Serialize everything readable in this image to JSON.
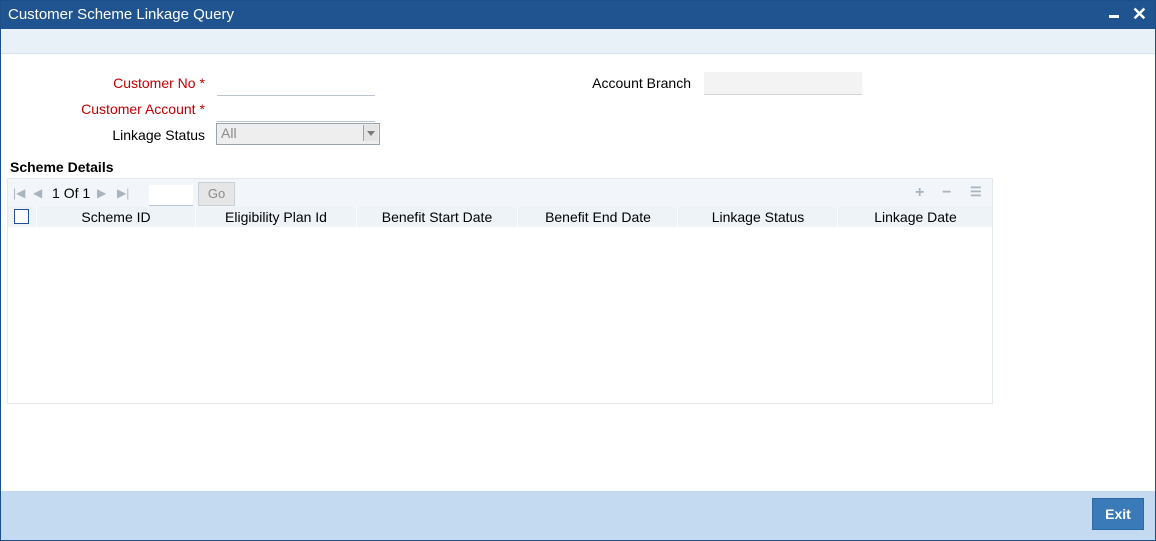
{
  "window": {
    "title": "Customer Scheme Linkage Query"
  },
  "form": {
    "customer_no_label": "Customer No",
    "customer_account_label": "Customer Account",
    "linkage_status_label": "Linkage Status",
    "linkage_status_value": "All",
    "account_branch_label": "Account Branch",
    "required_mark": "*"
  },
  "scheme_details": {
    "title": "Scheme Details",
    "page_current": "1",
    "page_of": "Of",
    "page_total": "1",
    "go_label": "Go",
    "columns": [
      "Scheme ID",
      "Eligibility Plan Id",
      "Benefit Start Date",
      "Benefit End Date",
      "Linkage Status",
      "Linkage Date"
    ]
  },
  "footer": {
    "exit_label": "Exit"
  },
  "colors": {
    "titlebar": "#1f5491",
    "required": "#c00000",
    "footer": "#c3daf0",
    "exit_button": "#3a7ab8"
  },
  "icons": [
    "minimize-icon",
    "close-icon",
    "first-page-icon",
    "prev-page-icon",
    "next-page-icon",
    "last-page-icon",
    "add-row-icon",
    "delete-row-icon",
    "view-list-icon"
  ]
}
